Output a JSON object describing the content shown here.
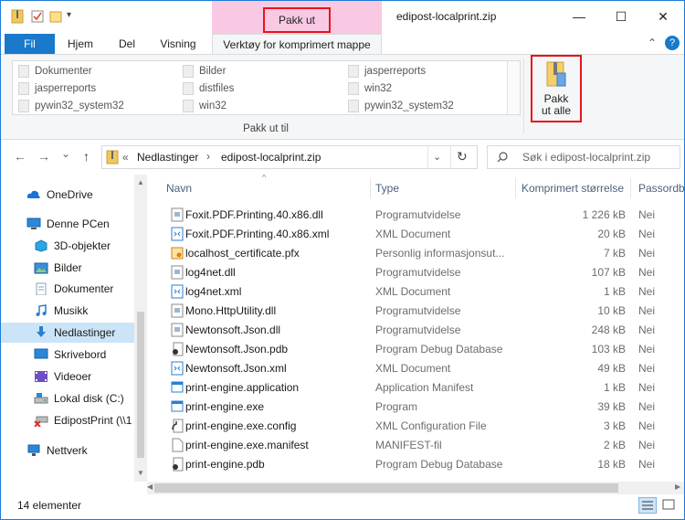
{
  "titlebar": {
    "context_title": "Pakk ut",
    "window_title": "edipost-localprint.zip",
    "minimize": "—",
    "maximize": "☐",
    "close": "✕"
  },
  "ribbon_tabs": {
    "file": "Fil",
    "home": "Hjem",
    "share": "Del",
    "view": "Visning",
    "context": "Verktøy for komprimert mappe",
    "collapse": "⌃",
    "help": "?"
  },
  "ribbon": {
    "gallery": [
      [
        "Dokumenter",
        "Bilder",
        "jasperreports"
      ],
      [
        "jasperreports",
        "distfiles",
        "win32"
      ],
      [
        "pywin32_system32",
        "win32",
        "pywin32_system32"
      ]
    ],
    "group_label": "Pakk ut til",
    "extract_all": [
      "Pakk",
      "ut alle"
    ]
  },
  "nav": {
    "back": "←",
    "forward": "→",
    "recent": "⌄",
    "up": "↑",
    "breadcrumb_prefix": "«",
    "breadcrumb": [
      "Nedlastinger",
      "edipost-localprint.zip"
    ],
    "breadcrumb_sep": "›",
    "refresh": "↻",
    "search_placeholder": "Søk i edipost-localprint.zip"
  },
  "navpane": [
    {
      "label": "OneDrive",
      "icon": "cloud-icon",
      "color": "#1a73d9"
    },
    {
      "label": "Denne PCen",
      "icon": "computer-icon",
      "color": "#2b88d8"
    },
    {
      "label": "3D-objekter",
      "icon": "cube-icon",
      "color": "#2aa6e0"
    },
    {
      "label": "Bilder",
      "icon": "pictures-icon",
      "color": "#3a8fd8"
    },
    {
      "label": "Dokumenter",
      "icon": "documents-icon",
      "color": "#8aa0b8"
    },
    {
      "label": "Musikk",
      "icon": "music-icon",
      "color": "#2b7fd1"
    },
    {
      "label": "Nedlastinger",
      "icon": "download-icon",
      "color": "#2b7fd1"
    },
    {
      "label": "Skrivebord",
      "icon": "desktop-icon",
      "color": "#2b88d8"
    },
    {
      "label": "Videoer",
      "icon": "video-icon",
      "color": "#6d4fc5"
    },
    {
      "label": "Lokal disk (C:)",
      "icon": "drive-icon",
      "color": "#7a7a7a"
    },
    {
      "label": "EdipostPrint (\\\\1",
      "icon": "network-drive-icon",
      "color": "#d9302a"
    },
    {
      "label": "Nettverk",
      "icon": "network-icon",
      "color": "#2b88d8"
    }
  ],
  "columns": {
    "name": "Navn",
    "type": "Type",
    "compressed_size": "Komprimert størrelse",
    "password": "Passordbe"
  },
  "files": [
    {
      "name": "Foxit.PDF.Printing.40.x86.dll",
      "type": "Programutvidelse",
      "size": "1 226 kB",
      "pw": "Nei",
      "icon": "dll-icon"
    },
    {
      "name": "Foxit.PDF.Printing.40.x86.xml",
      "type": "XML Document",
      "size": "20 kB",
      "pw": "Nei",
      "icon": "xml-icon"
    },
    {
      "name": "localhost_certificate.pfx",
      "type": "Personlig informasjonsut...",
      "size": "7 kB",
      "pw": "Nei",
      "icon": "certificate-icon"
    },
    {
      "name": "log4net.dll",
      "type": "Programutvidelse",
      "size": "107 kB",
      "pw": "Nei",
      "icon": "dll-icon"
    },
    {
      "name": "log4net.xml",
      "type": "XML Document",
      "size": "1 kB",
      "pw": "Nei",
      "icon": "xml-icon"
    },
    {
      "name": "Mono.HttpUtility.dll",
      "type": "Programutvidelse",
      "size": "10 kB",
      "pw": "Nei",
      "icon": "dll-icon"
    },
    {
      "name": "Newtonsoft.Json.dll",
      "type": "Programutvidelse",
      "size": "248 kB",
      "pw": "Nei",
      "icon": "dll-icon"
    },
    {
      "name": "Newtonsoft.Json.pdb",
      "type": "Program Debug Database",
      "size": "103 kB",
      "pw": "Nei",
      "icon": "pdb-icon"
    },
    {
      "name": "Newtonsoft.Json.xml",
      "type": "XML Document",
      "size": "49 kB",
      "pw": "Nei",
      "icon": "xml-icon"
    },
    {
      "name": "print-engine.application",
      "type": "Application Manifest",
      "size": "1 kB",
      "pw": "Nei",
      "icon": "manifest-icon"
    },
    {
      "name": "print-engine.exe",
      "type": "Program",
      "size": "39 kB",
      "pw": "Nei",
      "icon": "exe-icon"
    },
    {
      "name": "print-engine.exe.config",
      "type": "XML Configuration File",
      "size": "3 kB",
      "pw": "Nei",
      "icon": "config-icon"
    },
    {
      "name": "print-engine.exe.manifest",
      "type": "MANIFEST-fil",
      "size": "2 kB",
      "pw": "Nei",
      "icon": "file-icon"
    },
    {
      "name": "print-engine.pdb",
      "type": "Program Debug Database",
      "size": "18 kB",
      "pw": "Nei",
      "icon": "pdb-icon"
    }
  ],
  "status": {
    "count": "14 elementer"
  },
  "colors": {
    "accent": "#1979ca",
    "context_tab": "#f9c9e4",
    "highlight_box": "#e8141b",
    "selected": "#cce4f7"
  }
}
